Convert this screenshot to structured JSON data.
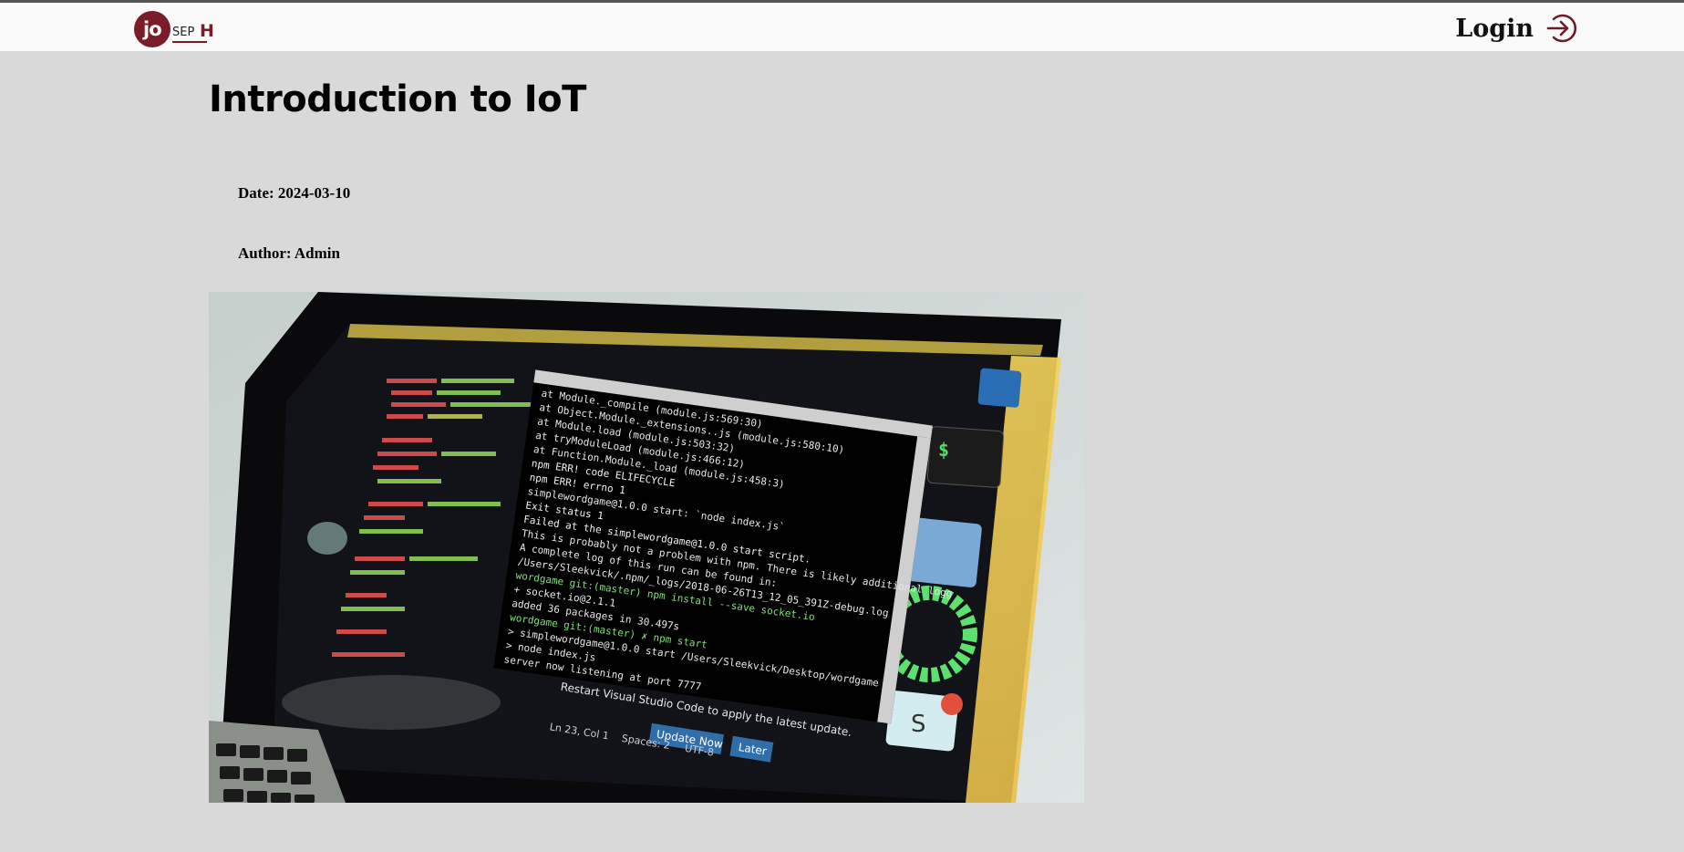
{
  "header": {
    "logo": {
      "part_jo": "jo",
      "part_sep": "SEP",
      "part_h": "H",
      "brand_color": "#7a1c2a"
    },
    "login_label": "Login",
    "login_icon": "login-arrow-circle-icon"
  },
  "article": {
    "title": "Introduction to IoT",
    "date_text": "Date: 2024-03-10",
    "author_text": "Author: Admin",
    "image": {
      "subject": "laptop-with-code-editor",
      "code_lines": [
        "at Module._compile (module.js:569:30)",
        "at Object.Module._extensions..js (module.js:580:10)",
        "at Module.load (module.js:503:32)",
        "at tryModuleLoad (module.js:466:12)",
        "at Function.Module._load (module.js:458:3)",
        "npm ERR! code ELIFECYCLE",
        "npm ERR! errno 1",
        "simplewordgame@1.0.0 start: `node index.js`",
        "Exit status 1",
        "Failed at the simplewordgame@1.0.0 start script.",
        "This is probably not a problem with npm. There is likely additional logg",
        "A complete log of this run can be found in:",
        "/Users/Sleekvick/.npm/_logs/2018-06-26T13_12_05_391Z-debug.log",
        "wordgame git:(master) npm install --save socket.io",
        "+ socket.io@2.1.1",
        "added 36 packages in 30.497s",
        "wordgame git:(master) ✗ npm start",
        "> simplewordgame@1.0.0 start /Users/Sleekvick/Desktop/wordgame",
        "> node index.js",
        "server now listening at port 7777"
      ],
      "notification": "Restart Visual Studio Code to apply the latest update.",
      "update_button": "Update Now",
      "later_button": "Later",
      "status_position": "Ln 23, Col 1",
      "status_spaces": "Spaces: 2",
      "status_encoding": "UTF-8"
    }
  }
}
